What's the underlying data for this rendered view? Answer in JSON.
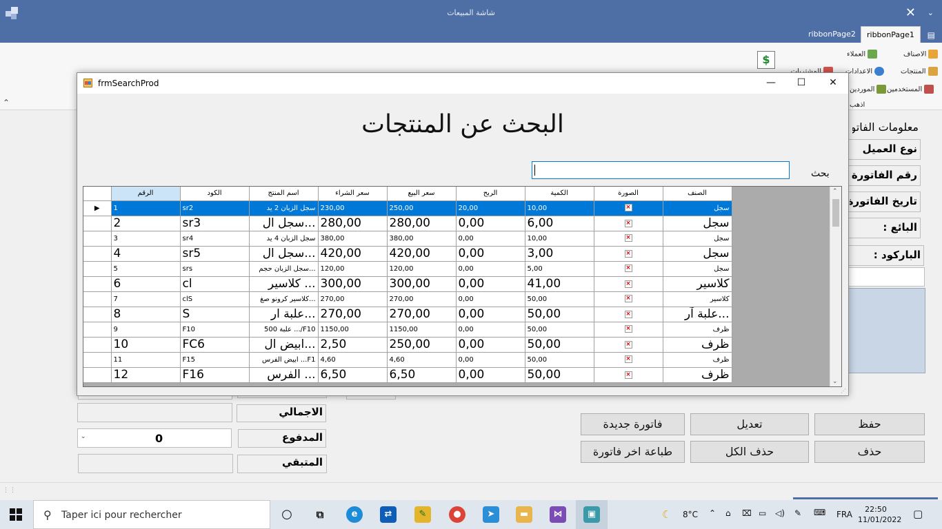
{
  "main_window": {
    "title": "شاشة المبيعات",
    "close": "✕",
    "collapse_caret": "⌄"
  },
  "ribbon": {
    "tabs": [
      "ribbonPage2",
      "ribbonPage1"
    ],
    "menu_icon": "▤",
    "collapse": "⌃",
    "items": {
      "categories": "الاصناف",
      "customers": "العملاء",
      "products": "المنتجات",
      "settings": "الاعدادات",
      "purchases": "المشتريات",
      "users": "المستخدمين",
      "suppliers": "الموردين",
      "go": "اذهب"
    },
    "dollar_label": "$"
  },
  "background_form": {
    "invoice_info_title": "معلومات الفاتورة",
    "customer_type": "نوع العميل",
    "invoice_number": "رقم الفاتورة :",
    "invoice_date": "تاريخ الفاتورة",
    "seller": "البائع :",
    "barcode": "الباركود :",
    "total": "الاجمالي",
    "paid": "المدفوع",
    "paid_value": "0",
    "remaining": "المتبقي",
    "buttons": {
      "save": "حفظ",
      "edit": "تعديل",
      "new_invoice": "فاتورة جديدة",
      "delete": "حذف",
      "delete_all": "حذف الكل",
      "print_last": "طباعة اخر فاتورة"
    }
  },
  "dialog": {
    "title": "frmSearchProd",
    "minimize": "—",
    "maximize": "☐",
    "close": "✕",
    "heading": "البحث عن المنتجات",
    "search_label": "بحث",
    "search_value": "",
    "grid": {
      "columns": [
        "الرقم",
        "الكود",
        "اسم المنتج",
        "سعر الشراء",
        "سعر البيع",
        "الربح",
        "الكمية",
        "الصورة",
        "الصنف"
      ],
      "rows": [
        {
          "no": "1",
          "code": "sr2",
          "name": "سجل الزبان 2 يد",
          "buy": "230,00",
          "sell": "250,00",
          "profit": "20,00",
          "qty": "10,00",
          "cat": "سجل",
          "size": "sm",
          "selected": true
        },
        {
          "no": "2",
          "code": "sr3",
          "name": "...سجل ال",
          "buy": "280,00",
          "sell": "280,00",
          "profit": "0,00",
          "qty": "6,00",
          "cat": "سجل",
          "size": "lg",
          "selected": false
        },
        {
          "no": "3",
          "code": "sr4",
          "name": "سجل الزبان 4 يد",
          "buy": "380,00",
          "sell": "380,00",
          "profit": "0,00",
          "qty": "10,00",
          "cat": "سجل",
          "size": "sm",
          "selected": false
        },
        {
          "no": "4",
          "code": "sr5",
          "name": "...سجل ال",
          "buy": "420,00",
          "sell": "420,00",
          "profit": "0,00",
          "qty": "3,00",
          "cat": "سجل",
          "size": "lg",
          "selected": false
        },
        {
          "no": "5",
          "code": "srs",
          "name": "...سجل الزبان حجم",
          "buy": "120,00",
          "sell": "120,00",
          "profit": "0,00",
          "qty": "5,00",
          "cat": "سجل",
          "size": "sm",
          "selected": false
        },
        {
          "no": "6",
          "code": "cl",
          "name": "... كلاسير",
          "buy": "300,00",
          "sell": "300,00",
          "profit": "0,00",
          "qty": "41,00",
          "cat": "كلاسير",
          "size": "lg",
          "selected": false
        },
        {
          "no": "7",
          "code": "clS",
          "name": "...كلاسير كرونو صغ",
          "buy": "270,00",
          "sell": "270,00",
          "profit": "0,00",
          "qty": "50,00",
          "cat": "كلاسير",
          "size": "sm",
          "selected": false
        },
        {
          "no": "8",
          "code": "S",
          "name": "...علبة ار",
          "buy": "270,00",
          "sell": "270,00",
          "profit": "0,00",
          "qty": "50,00",
          "cat": "...علبة آر",
          "size": "lg",
          "selected": false
        },
        {
          "no": "9",
          "code": "F10",
          "name": "F10/... علبة 500",
          "buy": "1150,00",
          "sell": "1150,00",
          "profit": "0,00",
          "qty": "50,00",
          "cat": "ظرف",
          "size": "sm",
          "selected": false
        },
        {
          "no": "10",
          "code": "FC6",
          "name": "...ابيض ال",
          "buy": "2,50",
          "sell": "250,00",
          "profit": "0,00",
          "qty": "50,00",
          "cat": "ظرف",
          "size": "lg",
          "selected": false
        },
        {
          "no": "11",
          "code": "F15",
          "name": "F1... ابيض الفرس",
          "buy": "4,60",
          "sell": "4,60",
          "profit": "0,00",
          "qty": "50,00",
          "cat": "ظرف",
          "size": "sm",
          "selected": false
        },
        {
          "no": "12",
          "code": "F16",
          "name": "... الفرس",
          "buy": "6,50",
          "sell": "6,50",
          "profit": "0,00",
          "qty": "50,00",
          "cat": "ظرف",
          "size": "lg",
          "selected": false
        }
      ],
      "row_pointer": "▶"
    }
  },
  "taskbar": {
    "search_placeholder": "Taper ici pour rechercher",
    "weather": "8°C",
    "language": "FRA",
    "time": "22:50",
    "date": "11/01/2022"
  }
}
